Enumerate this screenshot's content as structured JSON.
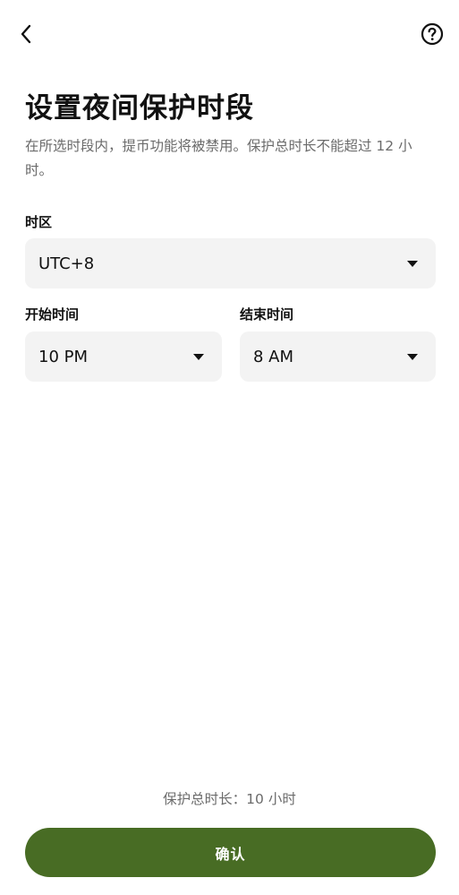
{
  "header": {
    "back_icon": "chevron-left-icon",
    "help_icon": "question-circle-icon"
  },
  "page": {
    "title": "设置夜间保护时段",
    "description": "在所选时段内，提币功能将被禁用。保护总时长不能超过 12 小时。"
  },
  "timezone": {
    "label": "时区",
    "value": "UTC+8"
  },
  "start_time": {
    "label": "开始时间",
    "value": "10 PM"
  },
  "end_time": {
    "label": "结束时间",
    "value": "8 AM"
  },
  "footer": {
    "total_text": "保护总时长：10 小时",
    "confirm_label": "确认"
  },
  "colors": {
    "accent": "#486c24",
    "field_bg": "#f3f3f3",
    "muted_text": "#6b6b6b"
  }
}
